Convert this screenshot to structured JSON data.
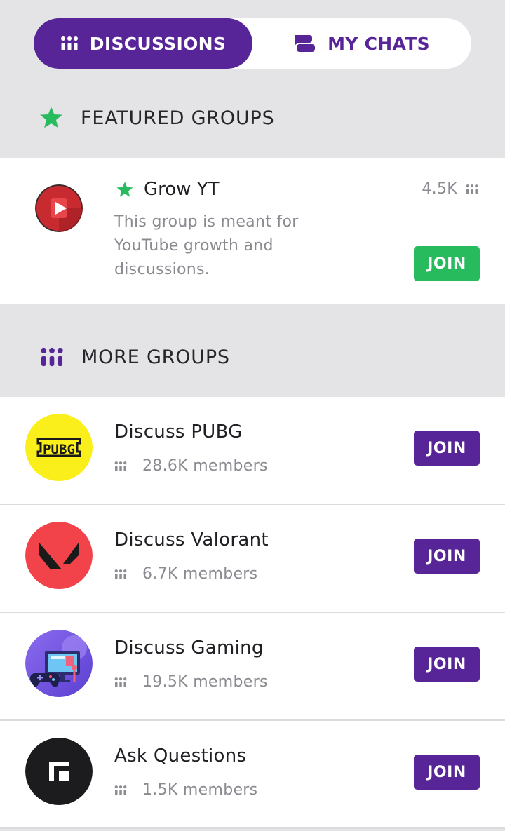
{
  "tabs": {
    "discussions": {
      "label": "DISCUSSIONS",
      "icon": "group-dots-icon"
    },
    "my_chats": {
      "label": "MY CHATS",
      "icon": "chat-bubbles-icon"
    }
  },
  "featured": {
    "heading": "FEATURED GROUPS",
    "icon": "star-icon",
    "group": {
      "name": "Grow YT",
      "description": "This group is meant for YouTube growth and discussions.",
      "count": "4.5K",
      "join_label": "JOIN",
      "avatar": "youtube-play-icon"
    }
  },
  "more": {
    "heading": "MORE GROUPS",
    "icon": "group-dots-icon",
    "groups": [
      {
        "name": "Discuss PUBG",
        "members": "28.6K members",
        "join_label": "JOIN",
        "avatar": "pubg-logo"
      },
      {
        "name": "Discuss Valorant",
        "members": "6.7K members",
        "join_label": "JOIN",
        "avatar": "valorant-logo"
      },
      {
        "name": "Discuss Gaming",
        "members": "19.5K members",
        "join_label": "JOIN",
        "avatar": "gaming-illustration"
      },
      {
        "name": "Ask Questions",
        "members": "1.5K members",
        "join_label": "JOIN",
        "avatar": "square-logo"
      }
    ]
  },
  "colors": {
    "primary": "#572597",
    "success": "#27bb5e",
    "background": "#e4e4e6",
    "star": "#27bb5e"
  }
}
